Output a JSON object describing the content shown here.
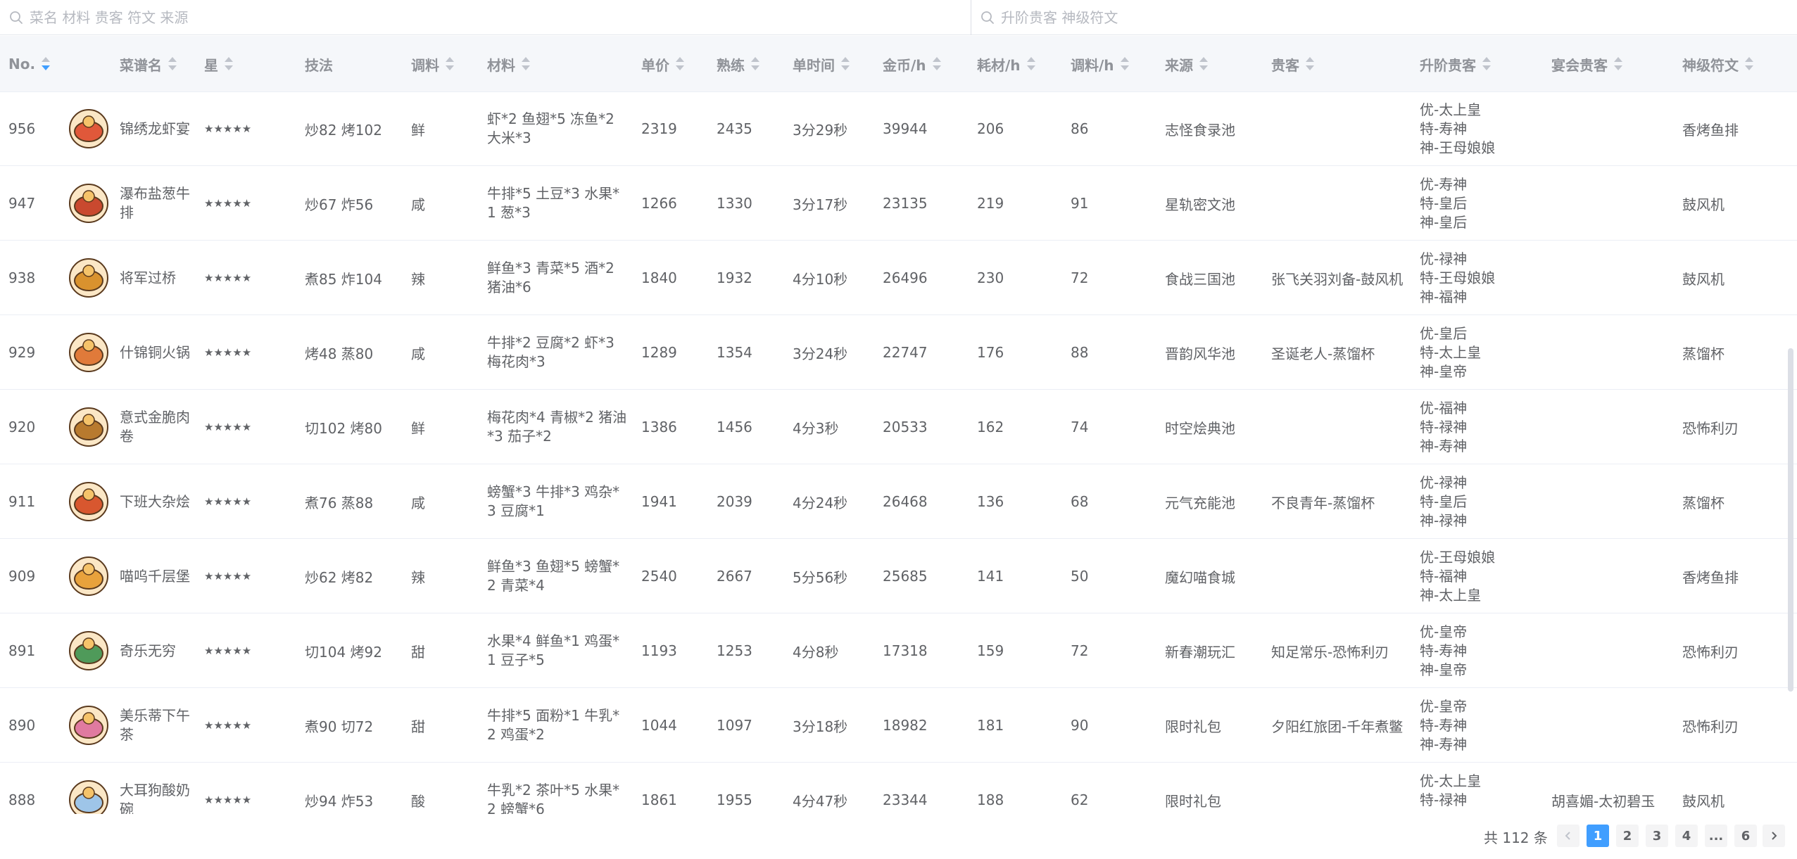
{
  "search": {
    "left_placeholder": "菜名 材料 贵客 符文 来源",
    "right_placeholder": "升阶贵客 神级符文"
  },
  "columns": [
    "No.",
    "菜谱名",
    "星",
    "技法",
    "调料",
    "材料",
    "单价",
    "熟练",
    "单时间",
    "金币/h",
    "耗材/h",
    "调料/h",
    "来源",
    "贵客",
    "升阶贵客",
    "宴会贵客",
    "神级符文"
  ],
  "rows": [
    {
      "no": "956",
      "name": "锦绣龙虾宴",
      "stars": "★★★★★",
      "skill": "炒82 烤102",
      "seasoning": "鲜",
      "materials": "虾*2 鱼翅*5 冻鱼*2 大米*3",
      "price": "2319",
      "skilled": "2435",
      "time": "3分29秒",
      "gold_h": "39944",
      "mat_h": "206",
      "sea_h": "86",
      "source": "志怪食录池",
      "guest": "",
      "up_guests": [
        "优-太上皇",
        "特-寿神",
        "神-王母娘娘"
      ],
      "banquet": "",
      "rune": "香烤鱼排",
      "icon_color": "#e0583a"
    },
    {
      "no": "947",
      "name": "瀑布盐葱牛排",
      "stars": "★★★★★",
      "skill": "炒67 炸56",
      "seasoning": "咸",
      "materials": "牛排*5 土豆*3 水果*1 葱*3",
      "price": "1266",
      "skilled": "1330",
      "time": "3分17秒",
      "gold_h": "23135",
      "mat_h": "219",
      "sea_h": "91",
      "source": "星轨密文池",
      "guest": "",
      "up_guests": [
        "优-寿神",
        "特-皇后",
        "神-皇后"
      ],
      "banquet": "",
      "rune": "鼓风机",
      "icon_color": "#c9492f"
    },
    {
      "no": "938",
      "name": "将军过桥",
      "stars": "★★★★★",
      "skill": "煮85 炸104",
      "seasoning": "辣",
      "materials": "鲜鱼*3 青菜*5 酒*2 猪油*6",
      "price": "1840",
      "skilled": "1932",
      "time": "4分10秒",
      "gold_h": "26496",
      "mat_h": "230",
      "sea_h": "72",
      "source": "食战三国池",
      "guest": "张飞关羽刘备-鼓风机",
      "up_guests": [
        "优-禄神",
        "特-王母娘娘",
        "神-福神"
      ],
      "banquet": "",
      "rune": "鼓风机",
      "icon_color": "#d9922e"
    },
    {
      "no": "929",
      "name": "什锦铜火锅",
      "stars": "★★★★★",
      "skill": "烤48 蒸80",
      "seasoning": "咸",
      "materials": "牛排*2 豆腐*2 虾*3 梅花肉*3",
      "price": "1289",
      "skilled": "1354",
      "time": "3分24秒",
      "gold_h": "22747",
      "mat_h": "176",
      "sea_h": "88",
      "source": "晋韵风华池",
      "guest": "圣诞老人-蒸馏杯",
      "up_guests": [
        "优-皇后",
        "特-太上皇",
        "神-皇帝"
      ],
      "banquet": "",
      "rune": "蒸馏杯",
      "icon_color": "#e07a3a"
    },
    {
      "no": "920",
      "name": "意式金脆肉卷",
      "stars": "★★★★★",
      "skill": "切102 烤80",
      "seasoning": "鲜",
      "materials": "梅花肉*4 青椒*2 猪油*3 茄子*2",
      "price": "1386",
      "skilled": "1456",
      "time": "4分3秒",
      "gold_h": "20533",
      "mat_h": "162",
      "sea_h": "74",
      "source": "时空烩典池",
      "guest": "",
      "up_guests": [
        "优-福神",
        "特-禄神",
        "神-寿神"
      ],
      "banquet": "",
      "rune": "恐怖利刃",
      "icon_color": "#b87a2e"
    },
    {
      "no": "911",
      "name": "下班大杂烩",
      "stars": "★★★★★",
      "skill": "煮76 蒸88",
      "seasoning": "咸",
      "materials": "螃蟹*3 牛排*3 鸡杂*3 豆腐*1",
      "price": "1941",
      "skilled": "2039",
      "time": "4分24秒",
      "gold_h": "26468",
      "mat_h": "136",
      "sea_h": "68",
      "source": "元气充能池",
      "guest": "不良青年-蒸馏杯",
      "up_guests": [
        "优-禄神",
        "特-皇后",
        "神-禄神"
      ],
      "banquet": "",
      "rune": "蒸馏杯",
      "icon_color": "#d8572f"
    },
    {
      "no": "909",
      "name": "喵呜千层堡",
      "stars": "★★★★★",
      "skill": "炒62 烤82",
      "seasoning": "辣",
      "materials": "鲜鱼*3 鱼翅*5 螃蟹*2 青菜*4",
      "price": "2540",
      "skilled": "2667",
      "time": "5分56秒",
      "gold_h": "25685",
      "mat_h": "141",
      "sea_h": "50",
      "source": "魔幻喵食城",
      "guest": "",
      "up_guests": [
        "优-王母娘娘",
        "特-福神",
        "神-太上皇"
      ],
      "banquet": "",
      "rune": "香烤鱼排",
      "icon_color": "#e8a23c"
    },
    {
      "no": "891",
      "name": "奇乐无穷",
      "stars": "★★★★★",
      "skill": "切104 烤92",
      "seasoning": "甜",
      "materials": "水果*4 鲜鱼*1 鸡蛋*1 豆子*5",
      "price": "1193",
      "skilled": "1253",
      "time": "4分8秒",
      "gold_h": "17318",
      "mat_h": "159",
      "sea_h": "72",
      "source": "新春潮玩汇",
      "guest": "知足常乐-恐怖利刃",
      "up_guests": [
        "优-皇帝",
        "特-寿神",
        "神-皇帝"
      ],
      "banquet": "",
      "rune": "恐怖利刃",
      "icon_color": "#4f9a5a"
    },
    {
      "no": "890",
      "name": "美乐蒂下午茶",
      "stars": "★★★★★",
      "skill": "煮90 切72",
      "seasoning": "甜",
      "materials": "牛排*5 面粉*1 牛乳*2 鸡蛋*2",
      "price": "1044",
      "skilled": "1097",
      "time": "3分18秒",
      "gold_h": "18982",
      "mat_h": "181",
      "sea_h": "90",
      "source": "限时礼包",
      "guest": "夕阳红旅团-千年煮鳖",
      "up_guests": [
        "优-皇帝",
        "特-寿神",
        "神-寿神"
      ],
      "banquet": "",
      "rune": "恐怖利刃",
      "icon_color": "#e07aa0"
    },
    {
      "no": "888",
      "name": "大耳狗酸奶碗",
      "stars": "★★★★★",
      "skill": "炒94 炸53",
      "seasoning": "酸",
      "materials": "牛乳*2 茶叶*5 水果*2 螃蟹*6",
      "price": "1861",
      "skilled": "1955",
      "time": "4分47秒",
      "gold_h": "23344",
      "mat_h": "188",
      "sea_h": "62",
      "source": "限时礼包",
      "guest": "",
      "up_guests": [
        "优-太上皇",
        "特-禄神",
        ""
      ],
      "banquet": "胡喜媚-太初碧玉",
      "rune": "鼓风机",
      "icon_color": "#9ec5e8"
    }
  ],
  "pagination": {
    "total": "共 112 条",
    "pages": [
      "1",
      "2",
      "3",
      "4",
      "...",
      "6"
    ],
    "current": "1",
    "prev_icon": "chevron-left-icon",
    "next_icon": "chevron-right-icon"
  },
  "colors": {
    "accent": "#409eff",
    "header_bg": "#f5f7fa",
    "border": "#ebeef5"
  }
}
